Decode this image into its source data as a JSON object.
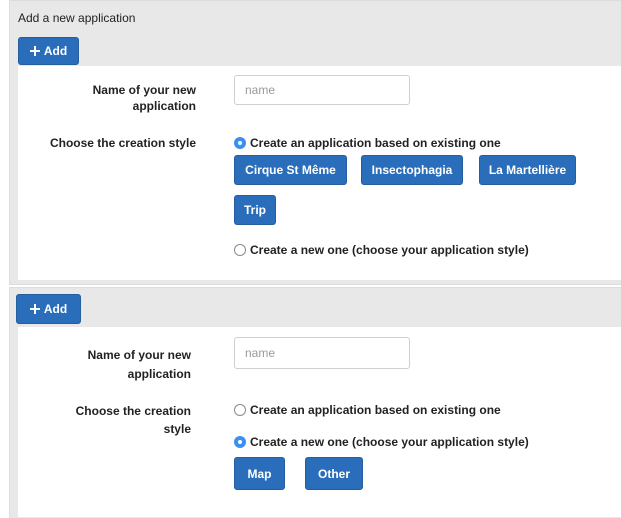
{
  "panel1": {
    "title": "Add a new application",
    "add_label": "Add",
    "name_label": "Name of your new application",
    "name_placeholder": "name",
    "style_label": "Choose the creation style",
    "option_existing": "Create an application based on existing one",
    "option_new": "Create a new one (choose your application style)",
    "selected": "existing",
    "existing_apps": [
      "Cirque St Même",
      "Insectophagia",
      "La Martellière",
      "Trip"
    ]
  },
  "panel2": {
    "add_label": "Add",
    "name_label": "Name of your new application",
    "name_placeholder": "name",
    "style_label": "Choose the creation style",
    "option_existing": "Create an application based on existing one",
    "option_new": "Create a new one (choose your application style)",
    "selected": "new",
    "styles": [
      "Map",
      "Other"
    ]
  },
  "colors": {
    "primary_button": "#2a6ebb",
    "radio_checked": "#3b8ff0",
    "panel_header": "#e8e8e8"
  }
}
